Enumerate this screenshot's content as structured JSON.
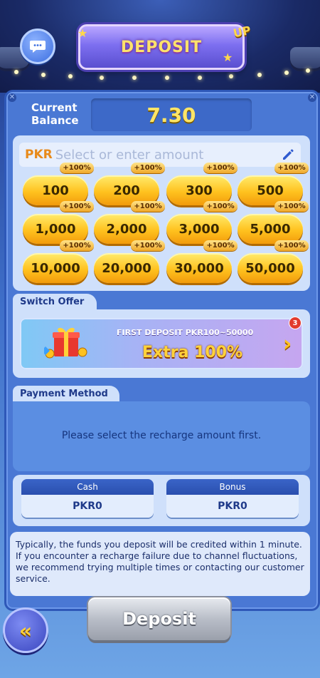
{
  "header": {
    "title": "DEPOSIT",
    "badge": "UP",
    "chat_icon": "chat-bubble-icon"
  },
  "balance": {
    "label_line1": "Current",
    "label_line2": "Balance",
    "value": "7.30"
  },
  "amount_input": {
    "currency": "PKR",
    "placeholder": "Select or enter amount",
    "edit_icon": "pencil-icon"
  },
  "amounts": [
    {
      "label": "100",
      "bonus": "+100%"
    },
    {
      "label": "200",
      "bonus": "+100%"
    },
    {
      "label": "300",
      "bonus": "+100%"
    },
    {
      "label": "500",
      "bonus": "+100%"
    },
    {
      "label": "1,000",
      "bonus": "+100%"
    },
    {
      "label": "2,000",
      "bonus": "+100%"
    },
    {
      "label": "3,000",
      "bonus": "+100%"
    },
    {
      "label": "5,000",
      "bonus": "+100%"
    },
    {
      "label": "10,000",
      "bonus": "+100%"
    },
    {
      "label": "20,000",
      "bonus": "+100%"
    },
    {
      "label": "30,000",
      "bonus": "+100%"
    },
    {
      "label": "50,000",
      "bonus": "+100%"
    }
  ],
  "offer": {
    "section_label": "Switch Offer",
    "title": "FIRST DEPOSIT  PKR100~50000",
    "headline": "Extra 100%",
    "badge_count": "3",
    "arrow": "›"
  },
  "payment": {
    "section_label": "Payment Method",
    "message": "Please select the recharge amount first."
  },
  "wallets": [
    {
      "label": "Cash",
      "value": "PKR0"
    },
    {
      "label": "Bonus",
      "value": "PKR0"
    }
  ],
  "notice": "Typically, the funds you deposit will be credited within 1 minute. If you encounter a recharge failure due to channel fluctuations, we recommend trying multiple times or contacting our customer service.",
  "footer": {
    "deposit_label": "Deposit",
    "back_symbol": "«"
  },
  "colors": {
    "accent_gold": "#ffc21f",
    "panel_blue": "#4a78d4",
    "button_disabled": "#b9bec8",
    "badge_red": "#e23b2e"
  }
}
